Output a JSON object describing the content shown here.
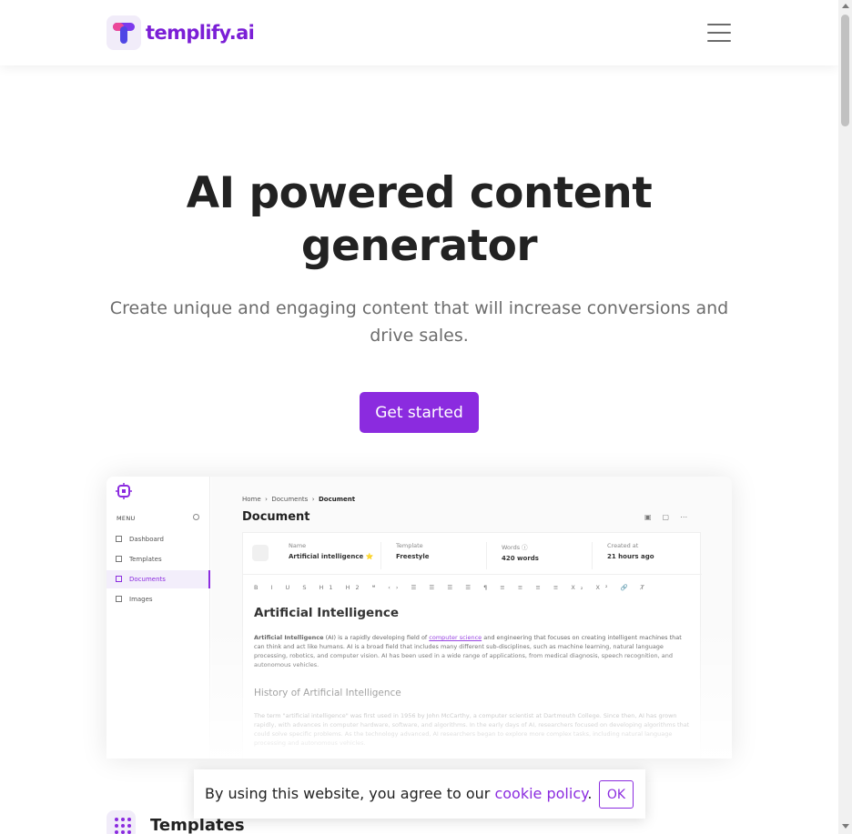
{
  "navbar": {
    "brand_name": "templify.ai",
    "logo_icon": "templify-t-logo-icon",
    "menu_icon": "hamburger-menu-icon"
  },
  "hero": {
    "title": "AI powered content generator",
    "subtitle": "Create unique and engaging content that will increase conversions and drive sales.",
    "cta_label": "Get started"
  },
  "preview": {
    "sidebar": {
      "logo_icon": "chip-icon",
      "menu_label": "MENU",
      "items": [
        {
          "label": "Dashboard",
          "icon": "dashboard-icon",
          "active": false
        },
        {
          "label": "Templates",
          "icon": "grid-icon",
          "active": false
        },
        {
          "label": "Documents",
          "icon": "document-icon",
          "active": true
        },
        {
          "label": "Images",
          "icon": "image-icon",
          "active": false
        }
      ]
    },
    "breadcrumb": [
      "Home",
      "Documents",
      "Document"
    ],
    "title": "Document",
    "meta": [
      {
        "key": "Name",
        "value": "Artificial intelligence ⭐"
      },
      {
        "key": "Template",
        "value": "Freestyle"
      },
      {
        "key": "Words ⓘ",
        "value": "420 words"
      },
      {
        "key": "Created at",
        "value": "21 hours ago"
      }
    ],
    "toolbar": "B I U S   H1 H2 ❝ ‹›   ☰ ☰ ☰ ☰   ¶ ≡ ≡ ≡ ≡   X₂ X²   🔗 T̸",
    "doc_heading": "Artificial Intelligence",
    "doc_p1_bold": "Artificial Intelligence",
    "doc_p1_a": " (AI) is a rapidly developing field of ",
    "doc_p1_link": "computer science",
    "doc_p1_b": " and engineering that focuses on creating intelligent machines that can think and act like humans. AI is a broad field that includes many different sub-disciplines, such as machine learning, natural language processing, robotics, and computer vision. AI has been used in a wide range of applications, from medical diagnosis, speech recognition, and autonomous vehicles.",
    "doc_heading2": "History of Artificial Intelligence",
    "doc_p2": "The term \"artificial intelligence\" was first used in 1956 by John McCarthy, a computer scientist at Dartmouth College. Since then, AI has grown rapidly, with advances in computer hardware, software, and algorithms. In the early days of AI, researchers focused on developing algorithms that could solve specific problems. As the technology advanced, AI researchers began to explore more complex tasks, including natural language processing and autonomous vehicles."
  },
  "templates_section": {
    "title": "Templates",
    "icon": "dots-grid-icon"
  },
  "cookie": {
    "text_before": "By using this website, you agree to our ",
    "link_text": "cookie policy",
    "text_after": ".",
    "ok_label": "OK"
  },
  "colors": {
    "accent": "#8b2bdf",
    "brand_text": "#7b1fd6"
  }
}
